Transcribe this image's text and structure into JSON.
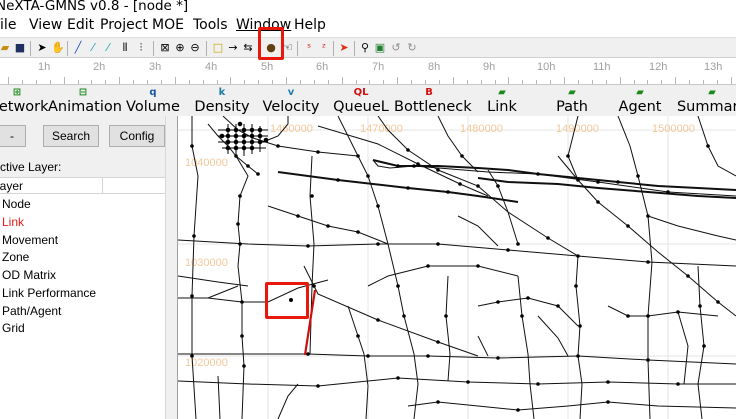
{
  "window": {
    "title": "NeXTA-GMNS v0.8 - [node *]"
  },
  "menu": [
    {
      "label": "File",
      "underline": false
    },
    {
      "label": "View",
      "underline": false
    },
    {
      "label": "Edit",
      "underline": false
    },
    {
      "label": "Project",
      "underline": false
    },
    {
      "label": "MOE",
      "underline": false
    },
    {
      "label": "Tools",
      "underline": false
    },
    {
      "label": "Window",
      "underline": true
    },
    {
      "label": "Help",
      "underline": false
    }
  ],
  "toolbar": {
    "icons": [
      "open-folder-icon",
      "save-icon",
      "select-arrow-icon",
      "hand-pan-icon",
      "draw-link-icon",
      "move-node-icon",
      "draw-zone-icon",
      "split-link-icon",
      "zoom-extent-icon",
      "zoom-in-icon",
      "zoom-out-icon",
      "rectangle-select-icon",
      "arrow-right-icon",
      "bidirectional-icon",
      "create-node-icon",
      "hand-drag-icon",
      "origin-zone-icon",
      "destination-zone-icon",
      "path-icon",
      "search-icon",
      "export-icon",
      "undo-icon",
      "redo-icon"
    ],
    "highlighted_icon": "create-node-icon"
  },
  "timeline": {
    "labels": [
      "1h",
      "2h",
      "3h",
      "4h",
      "5h",
      "6h",
      "7h",
      "8h",
      "9h",
      "10h",
      "11h",
      "12h",
      "13h"
    ]
  },
  "tabs": [
    {
      "label": "Network",
      "icon": "⊞",
      "color": "#1a8a1a"
    },
    {
      "label": "Animation",
      "icon": "⊟",
      "color": "#1a8a1a"
    },
    {
      "label": "Volume",
      "icon": "q",
      "color": "#1a5aa0"
    },
    {
      "label": "Density",
      "icon": "k",
      "color": "#1a7aa0"
    },
    {
      "label": "Velocity",
      "icon": "v",
      "color": "#2080b0"
    },
    {
      "label": "QueueL",
      "icon": "QL",
      "color": "#d01010"
    },
    {
      "label": "Bottleneck",
      "icon": "B",
      "color": "#d01010"
    },
    {
      "label": "Link",
      "icon": "▰",
      "color": "#1a8a1a"
    },
    {
      "label": "Path",
      "icon": "▰",
      "color": "#1a8a1a"
    },
    {
      "label": "Agent",
      "icon": "▰",
      "color": "#1a8a1a"
    },
    {
      "label": "Summary",
      "icon": "▰",
      "color": "#1a8a1a"
    }
  ],
  "left_panel": {
    "minus_button": "-",
    "search_button": "Search",
    "config_button": "Config",
    "active_layer_title": "Active Layer:",
    "list_header": "Layer",
    "layers": [
      {
        "label": "Node",
        "active": false
      },
      {
        "label": "Link",
        "active": true
      },
      {
        "label": "Movement",
        "active": false
      },
      {
        "label": "Zone",
        "active": false
      },
      {
        "label": "OD Matrix",
        "active": false
      },
      {
        "label": "Link Performance",
        "active": false
      },
      {
        "label": "Path/Agent",
        "active": false
      },
      {
        "label": "Grid",
        "active": false
      }
    ]
  },
  "map": {
    "x_coord_labels": [
      "1460000",
      "1470000",
      "1480000",
      "1490000",
      "1500000"
    ],
    "y_coord_labels": [
      "1040000",
      "1030000",
      "1020000"
    ],
    "selected_link_color": "#cc1010",
    "highlight_color": "#e8180c"
  }
}
